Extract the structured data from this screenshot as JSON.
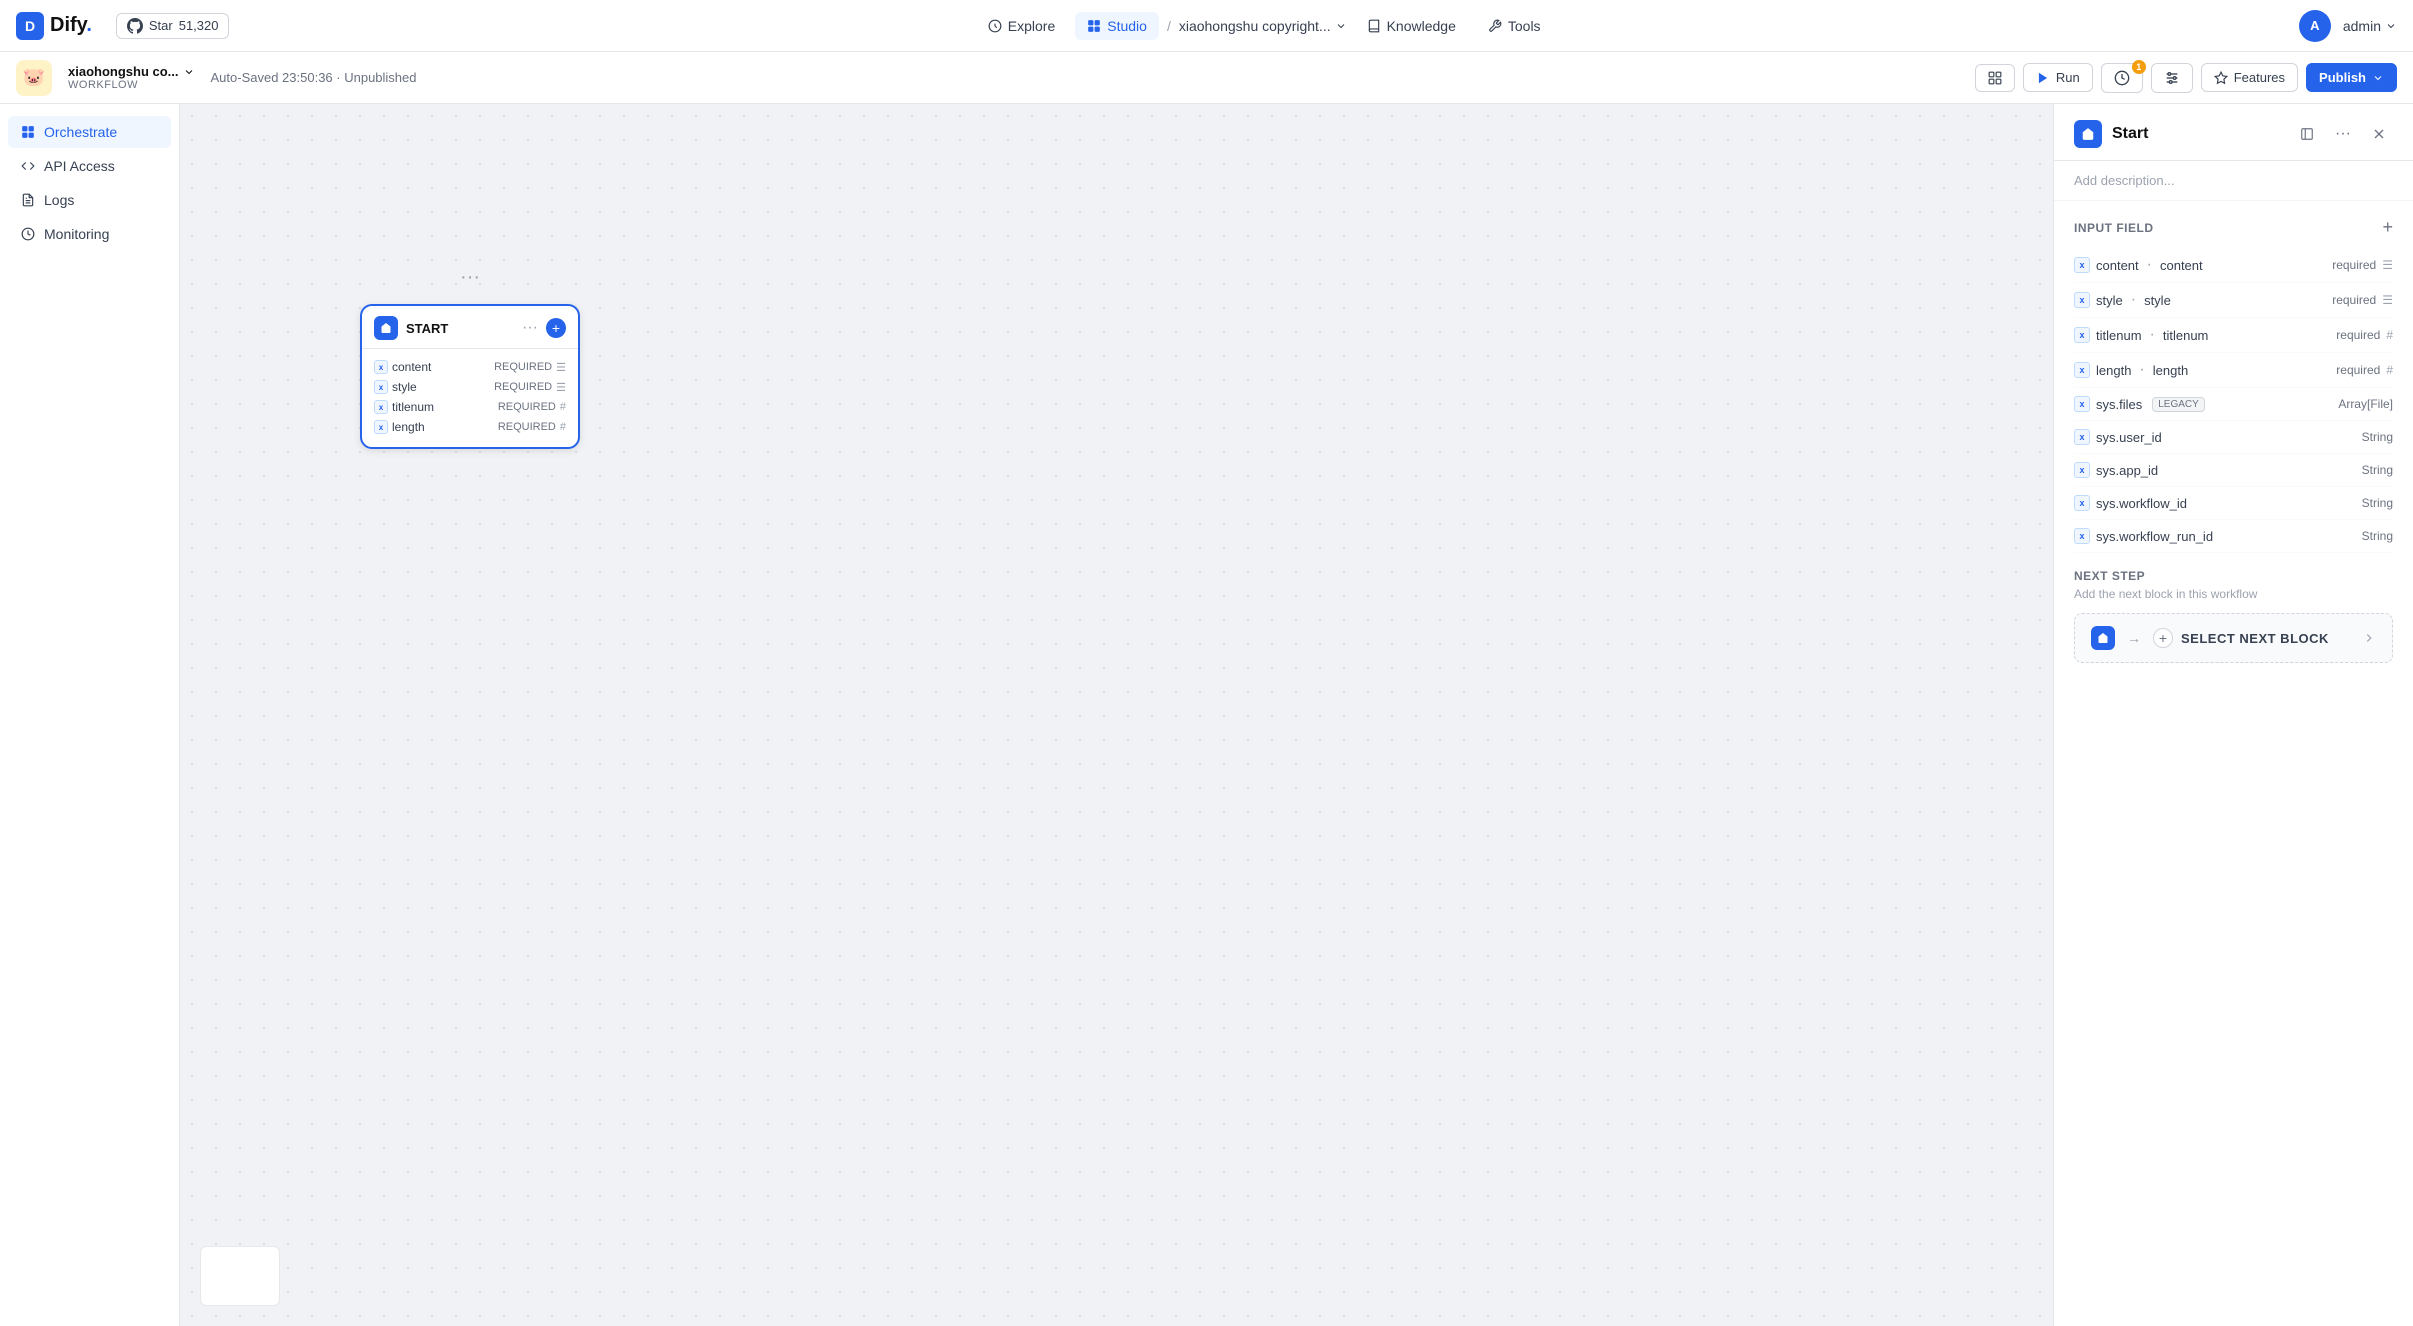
{
  "app": {
    "name": "Dify",
    "logo_letter": "D"
  },
  "github": {
    "star_label": "Star",
    "star_count": "51,320"
  },
  "nav": {
    "explore_label": "Explore",
    "studio_label": "Studio",
    "knowledge_label": "Knowledge",
    "tools_label": "Tools",
    "breadcrumb_name": "xiaohongshu copyright...",
    "breadcrumb_arrow": "/"
  },
  "user": {
    "avatar_letter": "A",
    "username": "admin"
  },
  "workflow_header": {
    "app_emoji": "🐷",
    "app_name": "xiaohongshu co...",
    "app_type": "WORKFLOW",
    "status": "Auto-Saved 23:50:36 · Unpublished",
    "run_label": "Run",
    "features_label": "Features",
    "publish_label": "Publish",
    "notification_count": "1"
  },
  "sidebar": {
    "items": [
      {
        "id": "orchestrate",
        "label": "Orchestrate",
        "active": true
      },
      {
        "id": "api-access",
        "label": "API Access",
        "active": false
      },
      {
        "id": "logs",
        "label": "Logs",
        "active": false
      },
      {
        "id": "monitoring",
        "label": "Monitoring",
        "active": false
      }
    ]
  },
  "canvas": {
    "start_node": {
      "title": "START",
      "fields": [
        {
          "name": "content",
          "required": "REQUIRED",
          "type_icon": "☰"
        },
        {
          "name": "style",
          "required": "REQUIRED",
          "type_icon": "☰"
        },
        {
          "name": "titlenum",
          "required": "REQUIRED",
          "type_icon": "#"
        },
        {
          "name": "length",
          "required": "REQUIRED",
          "type_icon": "#"
        }
      ]
    }
  },
  "right_panel": {
    "title": "Start",
    "description_placeholder": "Add description...",
    "input_field_section": "INPUT FIELD",
    "fields": [
      {
        "var": "x",
        "name": "content",
        "key": "content",
        "required": "required",
        "type": "☰",
        "is_sys": false
      },
      {
        "var": "x",
        "name": "style",
        "key": "style",
        "required": "required",
        "type": "☰",
        "is_sys": false
      },
      {
        "var": "x",
        "name": "titlenum",
        "key": "titlenum",
        "required": "required",
        "type": "#",
        "is_sys": false
      },
      {
        "var": "x",
        "name": "length",
        "key": "length",
        "required": "required",
        "type": "#",
        "is_sys": false
      }
    ],
    "sys_fields": [
      {
        "name": "sys.files",
        "type": "Array[File]",
        "badge": "LEGACY"
      },
      {
        "name": "sys.user_id",
        "type": "String"
      },
      {
        "name": "sys.app_id",
        "type": "String"
      },
      {
        "name": "sys.workflow_id",
        "type": "String"
      },
      {
        "name": "sys.workflow_run_id",
        "type": "String"
      }
    ],
    "next_step": {
      "title": "NEXT STEP",
      "subtitle": "Add the next block in this workflow",
      "select_label": "SELECT NEXT BLOCK"
    }
  }
}
